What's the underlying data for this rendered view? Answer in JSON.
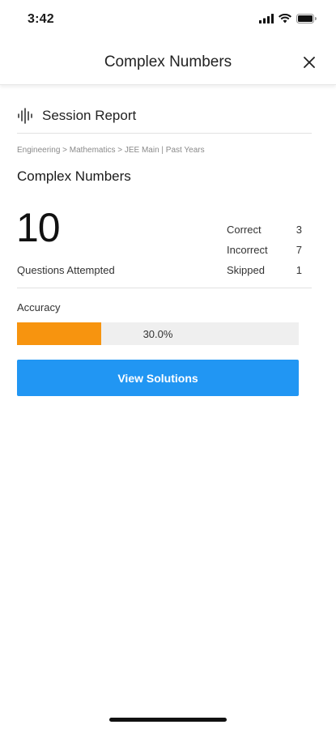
{
  "status_bar": {
    "time": "3:42",
    "icons": [
      "cellular-signal-icon",
      "wifi-icon",
      "battery-icon"
    ]
  },
  "nav": {
    "title": "Complex Numbers",
    "close_icon": "close-icon"
  },
  "report": {
    "title": "Session Report",
    "icon": "audio-wave-icon",
    "breadcrumb": "Engineering > Mathematics > JEE Main | Past Years",
    "topic": "Complex Numbers",
    "attempted_count": "10",
    "attempted_label": "Questions Attempted",
    "stats": [
      {
        "label": "Correct",
        "value": "3"
      },
      {
        "label": "Incorrect",
        "value": "7"
      },
      {
        "label": "Skipped",
        "value": "1"
      }
    ],
    "accuracy_label": "Accuracy",
    "accuracy_text": "30.0%",
    "accuracy_fraction": 0.3,
    "view_solutions_label": "View Solutions"
  },
  "colors": {
    "accent": "#2196f3",
    "accuracy_fill": "#f7940f",
    "accuracy_track": "#efefef"
  }
}
